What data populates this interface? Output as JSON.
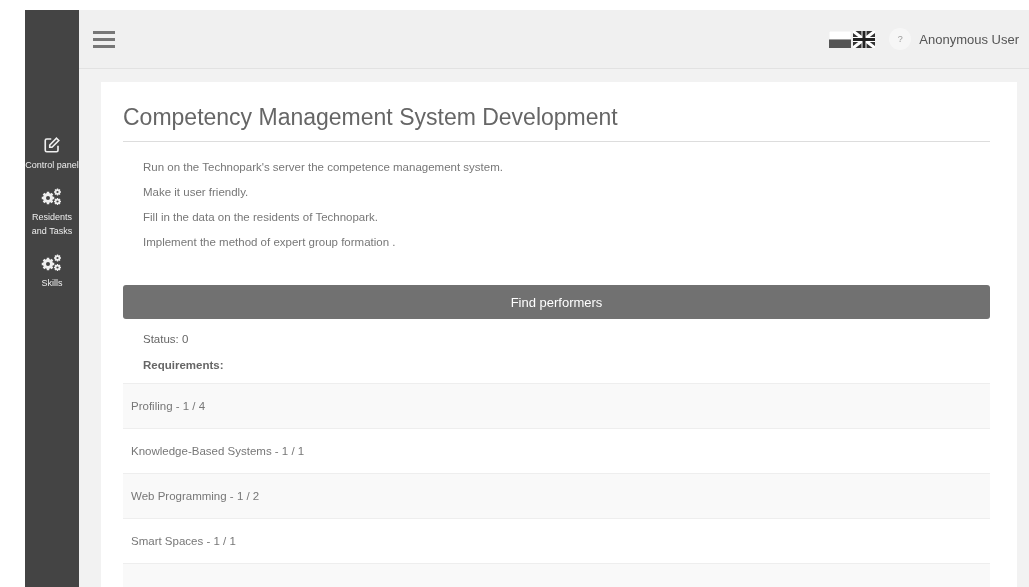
{
  "sidebar": {
    "items": [
      {
        "kind": "edit",
        "label": "Control panel"
      },
      {
        "kind": "gears",
        "label": "Residents and Tasks"
      },
      {
        "kind": "gears",
        "label": "Skills"
      }
    ]
  },
  "header": {
    "help": "?",
    "user": "Anonymous User"
  },
  "card": {
    "title": "Competency Management System Development",
    "tasks": [
      "Run on the Technopark's server the competence management system.",
      "Make it user friendly.",
      "Fill in the data on the residents of Technopark.",
      "Implement the method of expert group formation ."
    ],
    "button": "Find performers",
    "status": "Status: 0",
    "requirements_label": "Requirements:",
    "requirements": [
      "Profiling - 1 / 4",
      "Knowledge-Based Systems - 1 / 1",
      "Web Programming - 1 / 2",
      "Smart Spaces - 1 / 1"
    ]
  }
}
